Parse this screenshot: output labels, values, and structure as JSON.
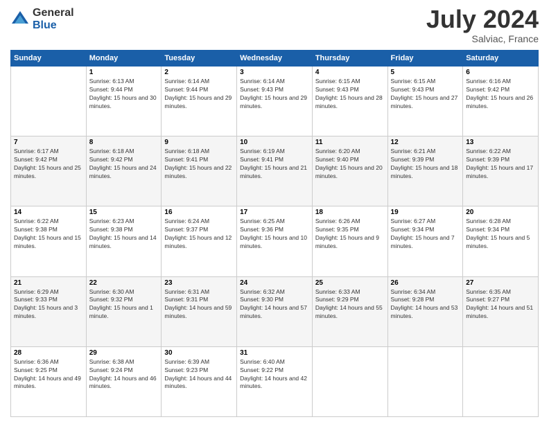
{
  "header": {
    "logo_general": "General",
    "logo_blue": "Blue",
    "title": "July 2024",
    "location": "Salviac, France"
  },
  "days_of_week": [
    "Sunday",
    "Monday",
    "Tuesday",
    "Wednesday",
    "Thursday",
    "Friday",
    "Saturday"
  ],
  "weeks": [
    [
      {
        "day": "",
        "empty": true
      },
      {
        "day": "1",
        "sunrise": "Sunrise: 6:13 AM",
        "sunset": "Sunset: 9:44 PM",
        "daylight": "Daylight: 15 hours and 30 minutes."
      },
      {
        "day": "2",
        "sunrise": "Sunrise: 6:14 AM",
        "sunset": "Sunset: 9:44 PM",
        "daylight": "Daylight: 15 hours and 29 minutes."
      },
      {
        "day": "3",
        "sunrise": "Sunrise: 6:14 AM",
        "sunset": "Sunset: 9:43 PM",
        "daylight": "Daylight: 15 hours and 29 minutes."
      },
      {
        "day": "4",
        "sunrise": "Sunrise: 6:15 AM",
        "sunset": "Sunset: 9:43 PM",
        "daylight": "Daylight: 15 hours and 28 minutes."
      },
      {
        "day": "5",
        "sunrise": "Sunrise: 6:15 AM",
        "sunset": "Sunset: 9:43 PM",
        "daylight": "Daylight: 15 hours and 27 minutes."
      },
      {
        "day": "6",
        "sunrise": "Sunrise: 6:16 AM",
        "sunset": "Sunset: 9:42 PM",
        "daylight": "Daylight: 15 hours and 26 minutes."
      }
    ],
    [
      {
        "day": "7",
        "sunrise": "Sunrise: 6:17 AM",
        "sunset": "Sunset: 9:42 PM",
        "daylight": "Daylight: 15 hours and 25 minutes."
      },
      {
        "day": "8",
        "sunrise": "Sunrise: 6:18 AM",
        "sunset": "Sunset: 9:42 PM",
        "daylight": "Daylight: 15 hours and 24 minutes."
      },
      {
        "day": "9",
        "sunrise": "Sunrise: 6:18 AM",
        "sunset": "Sunset: 9:41 PM",
        "daylight": "Daylight: 15 hours and 22 minutes."
      },
      {
        "day": "10",
        "sunrise": "Sunrise: 6:19 AM",
        "sunset": "Sunset: 9:41 PM",
        "daylight": "Daylight: 15 hours and 21 minutes."
      },
      {
        "day": "11",
        "sunrise": "Sunrise: 6:20 AM",
        "sunset": "Sunset: 9:40 PM",
        "daylight": "Daylight: 15 hours and 20 minutes."
      },
      {
        "day": "12",
        "sunrise": "Sunrise: 6:21 AM",
        "sunset": "Sunset: 9:39 PM",
        "daylight": "Daylight: 15 hours and 18 minutes."
      },
      {
        "day": "13",
        "sunrise": "Sunrise: 6:22 AM",
        "sunset": "Sunset: 9:39 PM",
        "daylight": "Daylight: 15 hours and 17 minutes."
      }
    ],
    [
      {
        "day": "14",
        "sunrise": "Sunrise: 6:22 AM",
        "sunset": "Sunset: 9:38 PM",
        "daylight": "Daylight: 15 hours and 15 minutes."
      },
      {
        "day": "15",
        "sunrise": "Sunrise: 6:23 AM",
        "sunset": "Sunset: 9:38 PM",
        "daylight": "Daylight: 15 hours and 14 minutes."
      },
      {
        "day": "16",
        "sunrise": "Sunrise: 6:24 AM",
        "sunset": "Sunset: 9:37 PM",
        "daylight": "Daylight: 15 hours and 12 minutes."
      },
      {
        "day": "17",
        "sunrise": "Sunrise: 6:25 AM",
        "sunset": "Sunset: 9:36 PM",
        "daylight": "Daylight: 15 hours and 10 minutes."
      },
      {
        "day": "18",
        "sunrise": "Sunrise: 6:26 AM",
        "sunset": "Sunset: 9:35 PM",
        "daylight": "Daylight: 15 hours and 9 minutes."
      },
      {
        "day": "19",
        "sunrise": "Sunrise: 6:27 AM",
        "sunset": "Sunset: 9:34 PM",
        "daylight": "Daylight: 15 hours and 7 minutes."
      },
      {
        "day": "20",
        "sunrise": "Sunrise: 6:28 AM",
        "sunset": "Sunset: 9:34 PM",
        "daylight": "Daylight: 15 hours and 5 minutes."
      }
    ],
    [
      {
        "day": "21",
        "sunrise": "Sunrise: 6:29 AM",
        "sunset": "Sunset: 9:33 PM",
        "daylight": "Daylight: 15 hours and 3 minutes."
      },
      {
        "day": "22",
        "sunrise": "Sunrise: 6:30 AM",
        "sunset": "Sunset: 9:32 PM",
        "daylight": "Daylight: 15 hours and 1 minute."
      },
      {
        "day": "23",
        "sunrise": "Sunrise: 6:31 AM",
        "sunset": "Sunset: 9:31 PM",
        "daylight": "Daylight: 14 hours and 59 minutes."
      },
      {
        "day": "24",
        "sunrise": "Sunrise: 6:32 AM",
        "sunset": "Sunset: 9:30 PM",
        "daylight": "Daylight: 14 hours and 57 minutes."
      },
      {
        "day": "25",
        "sunrise": "Sunrise: 6:33 AM",
        "sunset": "Sunset: 9:29 PM",
        "daylight": "Daylight: 14 hours and 55 minutes."
      },
      {
        "day": "26",
        "sunrise": "Sunrise: 6:34 AM",
        "sunset": "Sunset: 9:28 PM",
        "daylight": "Daylight: 14 hours and 53 minutes."
      },
      {
        "day": "27",
        "sunrise": "Sunrise: 6:35 AM",
        "sunset": "Sunset: 9:27 PM",
        "daylight": "Daylight: 14 hours and 51 minutes."
      }
    ],
    [
      {
        "day": "28",
        "sunrise": "Sunrise: 6:36 AM",
        "sunset": "Sunset: 9:25 PM",
        "daylight": "Daylight: 14 hours and 49 minutes."
      },
      {
        "day": "29",
        "sunrise": "Sunrise: 6:38 AM",
        "sunset": "Sunset: 9:24 PM",
        "daylight": "Daylight: 14 hours and 46 minutes."
      },
      {
        "day": "30",
        "sunrise": "Sunrise: 6:39 AM",
        "sunset": "Sunset: 9:23 PM",
        "daylight": "Daylight: 14 hours and 44 minutes."
      },
      {
        "day": "31",
        "sunrise": "Sunrise: 6:40 AM",
        "sunset": "Sunset: 9:22 PM",
        "daylight": "Daylight: 14 hours and 42 minutes."
      },
      {
        "day": "",
        "empty": true
      },
      {
        "day": "",
        "empty": true
      },
      {
        "day": "",
        "empty": true
      }
    ]
  ]
}
